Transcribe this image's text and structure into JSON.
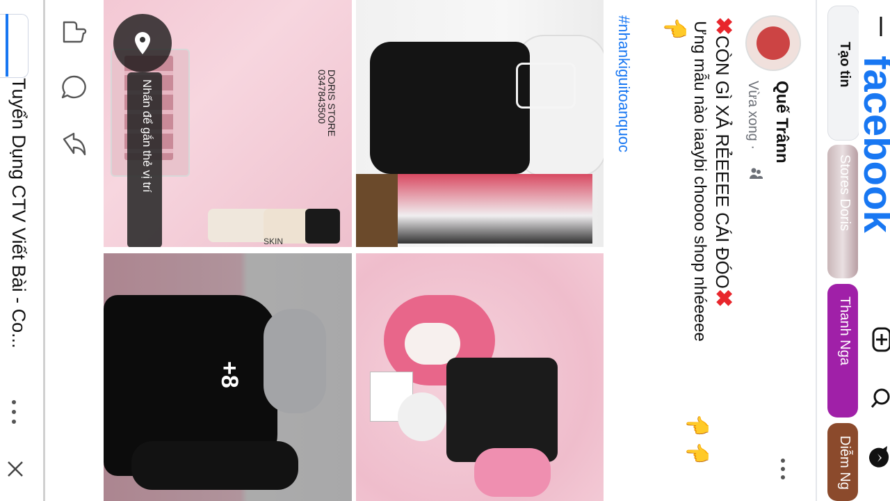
{
  "topbar": {
    "logo": "facebook",
    "menu_icon": "menu-icon",
    "actions": [
      "add-icon",
      "search-icon",
      "messenger-icon"
    ]
  },
  "stories": {
    "create_label": "Tạo tin",
    "items": [
      {
        "label": "Stores Doris"
      },
      {
        "label": "Thanh Nga"
      },
      {
        "label": "Diễm Ng"
      }
    ]
  },
  "post": {
    "author": "Quế Trânn",
    "time": "Vừa xong ·",
    "caption_line1": "CÒN GÌ XẢ RẺEEEE CÁI ĐÓO",
    "caption_line2": "Ưng mẫu nào iaaybi choooo shop nhéeeee",
    "hashtag": "#nhankiguitoanquoc",
    "more_count": "+8",
    "photo_texts": {
      "store_tag": "DORIS STORE",
      "phone": "0347843500",
      "product": "SKIN"
    },
    "tooltip": "Nhấn để gắn thẻ vị trí"
  },
  "bottom_sheet": {
    "title": "Tuyển Dụng CTV Viết Bài - Co..."
  },
  "colors": {
    "brand": "#1877f2",
    "story_purple": "#a020a8",
    "red_mark": "#e8262c"
  }
}
